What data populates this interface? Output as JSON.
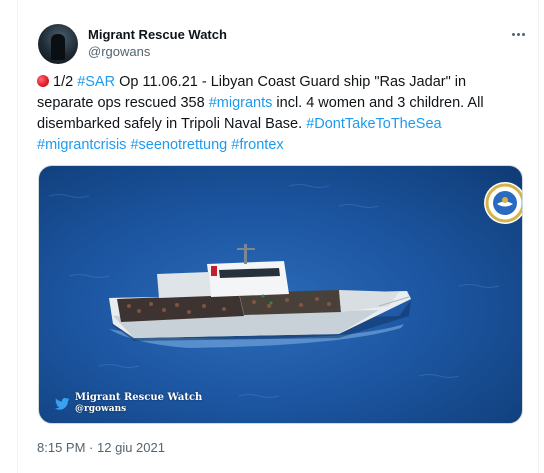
{
  "author": {
    "display_name": "Migrant Rescue Watch",
    "handle": "@rgowans"
  },
  "tweet": {
    "segments": [
      {
        "text": "1/2 ",
        "type": "plain"
      },
      {
        "text": "#SAR",
        "type": "hashtag"
      },
      {
        "text": " Op 11.06.21 - Libyan Coast Guard ship \"Ras Jadar\" in separate ops rescued 358 ",
        "type": "plain"
      },
      {
        "text": "#migrants",
        "type": "hashtag"
      },
      {
        "text": " incl. 4 women and 3 children. All disembarked safely in Tripoli Naval Base. ",
        "type": "plain"
      },
      {
        "text": "#DontTakeToTheSea",
        "type": "hashtag"
      },
      {
        "text": " ",
        "type": "plain"
      },
      {
        "text": "#migrantcrisis",
        "type": "hashtag"
      },
      {
        "text": " ",
        "type": "plain"
      },
      {
        "text": "#seenotrettung",
        "type": "hashtag"
      },
      {
        "text": " ",
        "type": "plain"
      },
      {
        "text": "#frontex",
        "type": "hashtag"
      }
    ],
    "status_emoji": "red-circle-icon"
  },
  "media": {
    "watermark_title": "Migrant Rescue Watch",
    "watermark_handle": "@rgowans",
    "colors": {
      "sea": "#1d57a3",
      "hull": "#e9edf0",
      "hashtag": "#1d9bf0"
    }
  },
  "meta": {
    "time": "8:15 PM",
    "separator": "·",
    "date": "12 giu 2021"
  },
  "icons": {
    "more": "more-horizontal-icon",
    "watermark_bird": "bird-icon",
    "emblem": "coast-guard-emblem-icon"
  }
}
